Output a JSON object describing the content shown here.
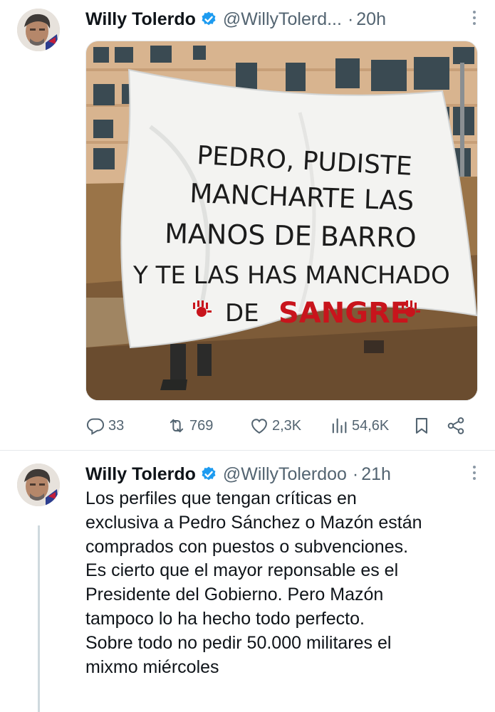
{
  "tweets": [
    {
      "author": "Willy Tolerdo",
      "handle": "@WillyTolerd...",
      "separator": "·",
      "time": "20h",
      "media": {
        "banner_lines": [
          "PEDRO, PUDISTE",
          "MANCHARTE LAS",
          "MANOS DE BARRO",
          "Y TE LAS HAS MANCHADO",
          "DE",
          "SANGRE"
        ]
      },
      "stats": {
        "replies": "33",
        "reposts": "769",
        "likes": "2,3K",
        "views": "54,6K"
      }
    },
    {
      "author": "Willy Tolerdo",
      "handle": "@WillyTolerdoo",
      "separator": "·",
      "time": "21h",
      "text_lines": [
        "Los perfiles que tengan críticas en",
        "exclusiva a Pedro Sánchez o Mazón están",
        "comprados con puestos o subvenciones.",
        "Es cierto que el mayor reponsable es el",
        "Presidente del Gobierno. Pero Mazón",
        "tampoco lo ha hecho todo perfecto.",
        "Sobre todo no pedir 50.000 militares el",
        "mixmo miércoles"
      ]
    }
  ],
  "colors": {
    "verified": "#1d9bf0",
    "secondary_text": "#536471",
    "blood_red": "#c8141c"
  },
  "icons": [
    "reply-icon",
    "repost-icon",
    "like-icon",
    "views-icon",
    "bookmark-icon",
    "share-icon",
    "verified-badge-icon",
    "more-icon"
  ]
}
